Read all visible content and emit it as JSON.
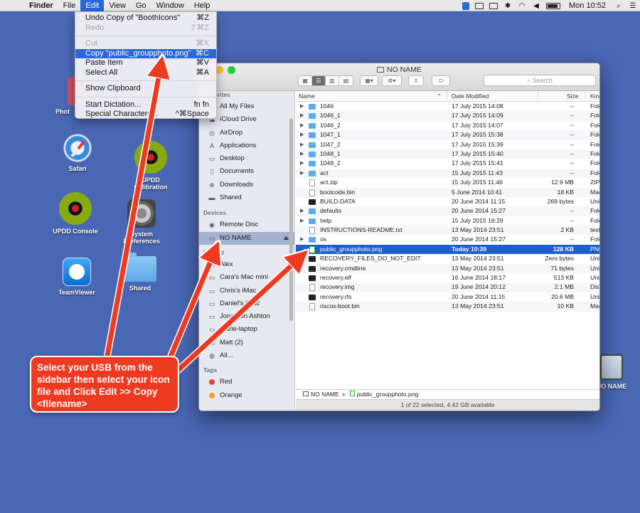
{
  "menubar": {
    "apple_icon": "apple-icon",
    "items": [
      "Finder",
      "File",
      "Edit",
      "View",
      "Go",
      "Window",
      "Help"
    ],
    "clock": "Mon 10:52"
  },
  "edit_menu": {
    "items": [
      {
        "label": "Undo Copy of \"BoothIcons\"",
        "shortcut": "⌘Z",
        "state": "enabled"
      },
      {
        "label": "Redo",
        "shortcut": "⇧⌘Z",
        "state": "disabled"
      },
      {
        "label": "Cut",
        "shortcut": "⌘X",
        "state": "disabled"
      },
      {
        "label": "Copy \"public_groupphoto.png\"",
        "shortcut": "⌘C",
        "state": "selected"
      },
      {
        "label": "Paste Item",
        "shortcut": "⌘V",
        "state": "enabled"
      },
      {
        "label": "Select All",
        "shortcut": "⌘A",
        "state": "enabled"
      },
      {
        "label": "Show Clipboard",
        "shortcut": "",
        "state": "enabled"
      },
      {
        "label": "Start Dictation...",
        "shortcut": "fn fn",
        "state": "enabled"
      },
      {
        "label": "Special Characters...",
        "shortcut": "^⌘Space",
        "state": "enabled"
      }
    ]
  },
  "desktop_icons": [
    {
      "label": "Phot",
      "icon": "pink-app-icon"
    },
    {
      "label": "Safari",
      "icon": "safari-icon"
    },
    {
      "label": "UPDD Calibration",
      "icon": "swirl-icon"
    },
    {
      "label": "UPDD Console",
      "icon": "swirl-icon"
    },
    {
      "label": "System Preferences",
      "icon": "gear-icon"
    },
    {
      "label": "TeamViewer",
      "icon": "teamviewer-icon"
    },
    {
      "label": "Shared",
      "icon": "folder-icon"
    },
    {
      "label": "NO NAME",
      "icon": "drive-icon"
    }
  ],
  "finder": {
    "title": "NO NAME",
    "search_placeholder": "Search",
    "sidebar": {
      "favorites_header": "Favorites",
      "favorites": [
        {
          "label": "All My Files",
          "icon": "all-files-icon"
        },
        {
          "label": "iCloud Drive",
          "icon": "cloud-icon"
        },
        {
          "label": "AirDrop",
          "icon": "airdrop-icon"
        },
        {
          "label": "Applications",
          "icon": "applications-icon"
        },
        {
          "label": "Desktop",
          "icon": "desktop-icon"
        },
        {
          "label": "Documents",
          "icon": "documents-icon"
        },
        {
          "label": "Downloads",
          "icon": "downloads-icon"
        },
        {
          "label": "Shared",
          "icon": "shared-folder-icon"
        }
      ],
      "devices_header": "Devices",
      "devices": [
        {
          "label": "Remote Disc",
          "icon": "disc-icon",
          "selected": false
        },
        {
          "label": "NO NAME",
          "icon": "drive-icon",
          "selected": true
        }
      ],
      "shared_header": "Shared",
      "shared": [
        {
          "label": "Alex"
        },
        {
          "label": "Cara's Mac mini"
        },
        {
          "label": "Chris's iMac"
        },
        {
          "label": "Daniel's iMac"
        },
        {
          "label": "Jonathon Ashton"
        },
        {
          "label": "marie-laptop"
        },
        {
          "label": "Matt (2)"
        },
        {
          "label": "All..."
        }
      ],
      "tags_header": "Tags",
      "tags": [
        {
          "label": "Red",
          "color": "#e5443b"
        },
        {
          "label": "Orange",
          "color": "#f59a2b"
        }
      ]
    },
    "columns": {
      "name": "Name",
      "date": "Date Modified",
      "size": "Size",
      "kind": "Kind"
    },
    "rows": [
      {
        "name": "1046",
        "date": "17 July 2015 14:08",
        "size": "--",
        "kind": "Folder",
        "type": "folder",
        "expandable": true
      },
      {
        "name": "1046_1",
        "date": "17 July 2015 14:09",
        "size": "--",
        "kind": "Folder",
        "type": "folder",
        "expandable": true
      },
      {
        "name": "1046_2",
        "date": "17 July 2015 14:07",
        "size": "--",
        "kind": "Folder",
        "type": "folder",
        "expandable": true
      },
      {
        "name": "1047_1",
        "date": "17 July 2015 15:38",
        "size": "--",
        "kind": "Folder",
        "type": "folder",
        "expandable": true
      },
      {
        "name": "1047_2",
        "date": "17 July 2015 15:39",
        "size": "--",
        "kind": "Folder",
        "type": "folder",
        "expandable": true
      },
      {
        "name": "1048_1",
        "date": "17 July 2015 15:40",
        "size": "--",
        "kind": "Folder",
        "type": "folder",
        "expandable": true
      },
      {
        "name": "1048_2",
        "date": "17 July 2015 15:41",
        "size": "--",
        "kind": "Folder",
        "type": "folder",
        "expandable": true
      },
      {
        "name": "act",
        "date": "15 July 2015 11:43",
        "size": "--",
        "kind": "Folder",
        "type": "folder",
        "expandable": true
      },
      {
        "name": "act.zip",
        "date": "15 July 2015 11:46",
        "size": "12.9 MB",
        "kind": "ZIP",
        "type": "doc",
        "expandable": false
      },
      {
        "name": "bootcode.bin",
        "date": "5 June 2014 10:41",
        "size": "18 KB",
        "kind": "Mac",
        "type": "doc",
        "expandable": false
      },
      {
        "name": "BUILD-DATA",
        "date": "20 June 2014 11:15",
        "size": "269 bytes",
        "kind": "Unix",
        "type": "exec",
        "expandable": false
      },
      {
        "name": "defaults",
        "date": "20 June 2014 15:27",
        "size": "--",
        "kind": "Folder",
        "type": "folder",
        "expandable": true
      },
      {
        "name": "help",
        "date": "15 July 2015 16:29",
        "size": "--",
        "kind": "Folder",
        "type": "folder",
        "expandable": true
      },
      {
        "name": "INSTRUCTIONS-README.txt",
        "date": "13 May 2014 23:51",
        "size": "2 KB",
        "kind": "text",
        "type": "doc",
        "expandable": false
      },
      {
        "name": "os",
        "date": "20 June 2014 15:27",
        "size": "--",
        "kind": "Folder",
        "type": "folder",
        "expandable": true
      },
      {
        "name": "public_groupphoto.png",
        "date": "Today 10:39",
        "size": "128 KB",
        "kind": "PNG",
        "type": "img",
        "expandable": false,
        "selected": true
      },
      {
        "name": "RECOVERY_FILES_DO_NOT_EDIT",
        "date": "13 May 2014 23:51",
        "size": "Zero bytes",
        "kind": "Unix",
        "type": "exec",
        "expandable": false
      },
      {
        "name": "recovery.cmdline",
        "date": "13 May 2014 23:51",
        "size": "71 bytes",
        "kind": "Unix",
        "type": "exec",
        "expandable": false
      },
      {
        "name": "recovery.elf",
        "date": "16 June 2014 18:17",
        "size": "513 KB",
        "kind": "Unix",
        "type": "exec",
        "expandable": false
      },
      {
        "name": "recovery.img",
        "date": "19 June 2014 20:12",
        "size": "2.1 MB",
        "kind": "Disk",
        "type": "doc",
        "expandable": false
      },
      {
        "name": "recovery.rfs",
        "date": "20 June 2014 11:15",
        "size": "20.6 MB",
        "kind": "Unix",
        "type": "exec",
        "expandable": false
      },
      {
        "name": "riscos-boot.bin",
        "date": "13 May 2014 23:51",
        "size": "10 KB",
        "kind": "Mac",
        "type": "doc",
        "expandable": false
      }
    ],
    "path": [
      "NO NAME",
      "public_groupphoto.png"
    ],
    "status": "1 of 22 selected, 4.42 GB available"
  },
  "annotation": {
    "text": "Select your USB from the sidebar then select your icon file and Click Edit >> Copy <filename>",
    "color": "#ef3a22"
  }
}
